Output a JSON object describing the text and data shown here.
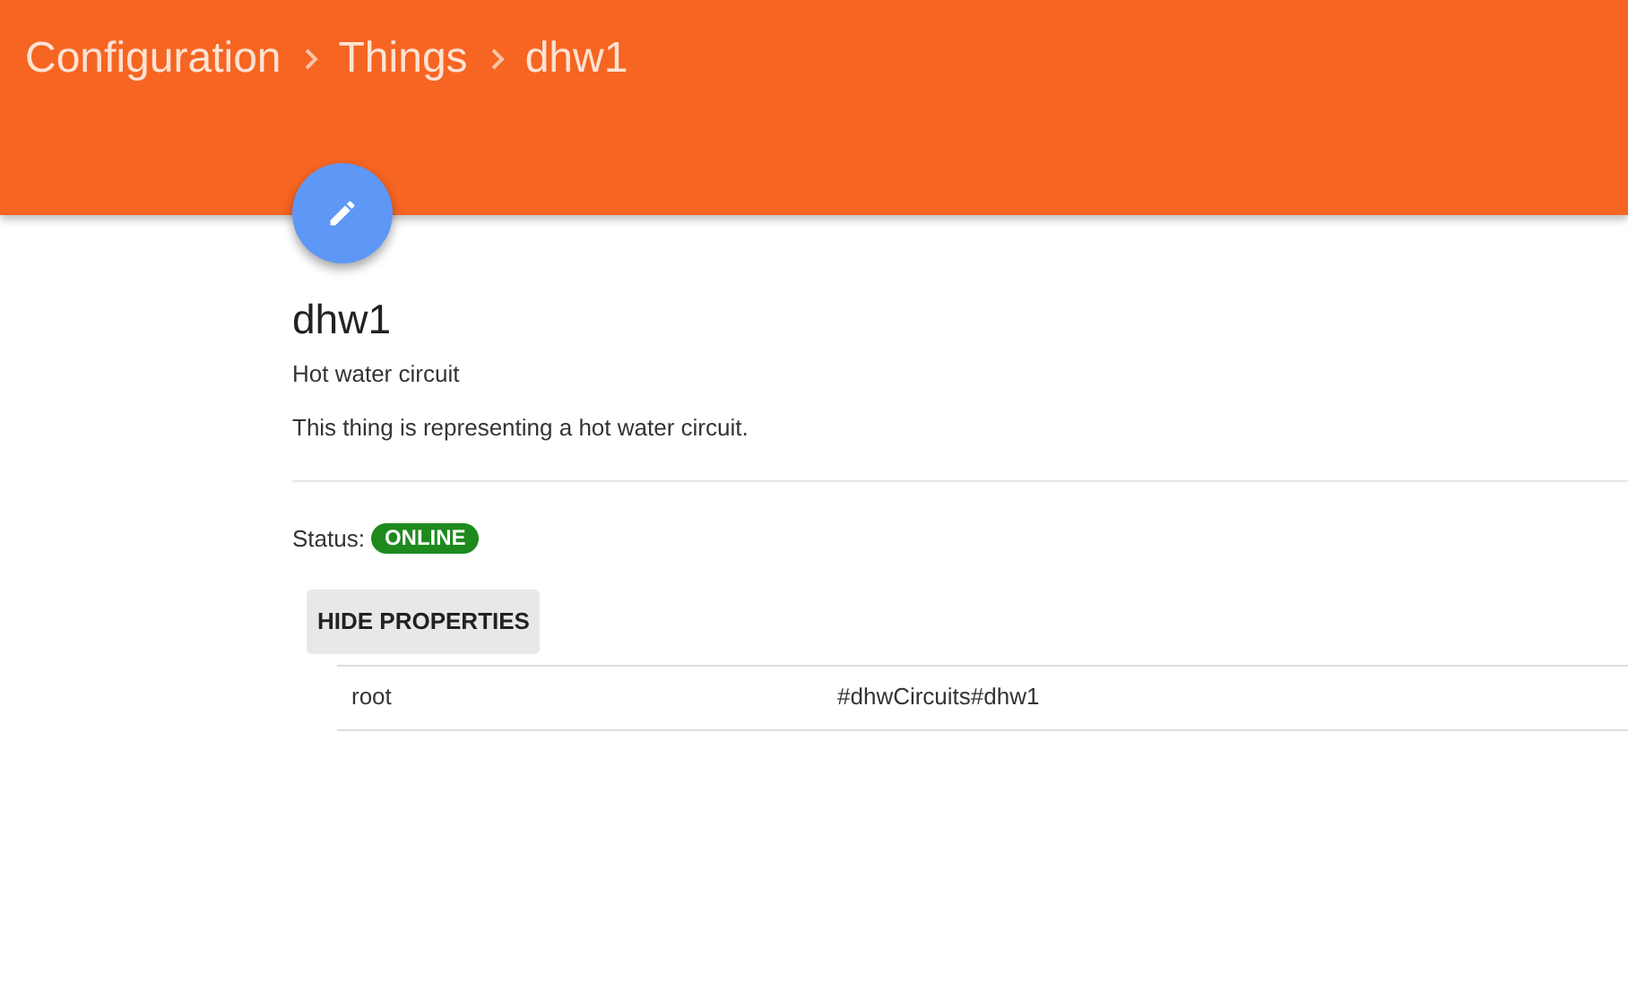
{
  "breadcrumb": [
    {
      "label": "Configuration"
    },
    {
      "label": "Things"
    },
    {
      "label": "dhw1"
    }
  ],
  "thing": {
    "title": "dhw1",
    "label": "Hot water circuit",
    "description": "This thing is representing a hot water circuit."
  },
  "status": {
    "label": "Status:",
    "value": "ONLINE",
    "kind": "online"
  },
  "properties_button": "HIDE PROPERTIES",
  "properties": [
    {
      "key": "root",
      "value": "#dhwCircuits#dhw1"
    }
  ]
}
